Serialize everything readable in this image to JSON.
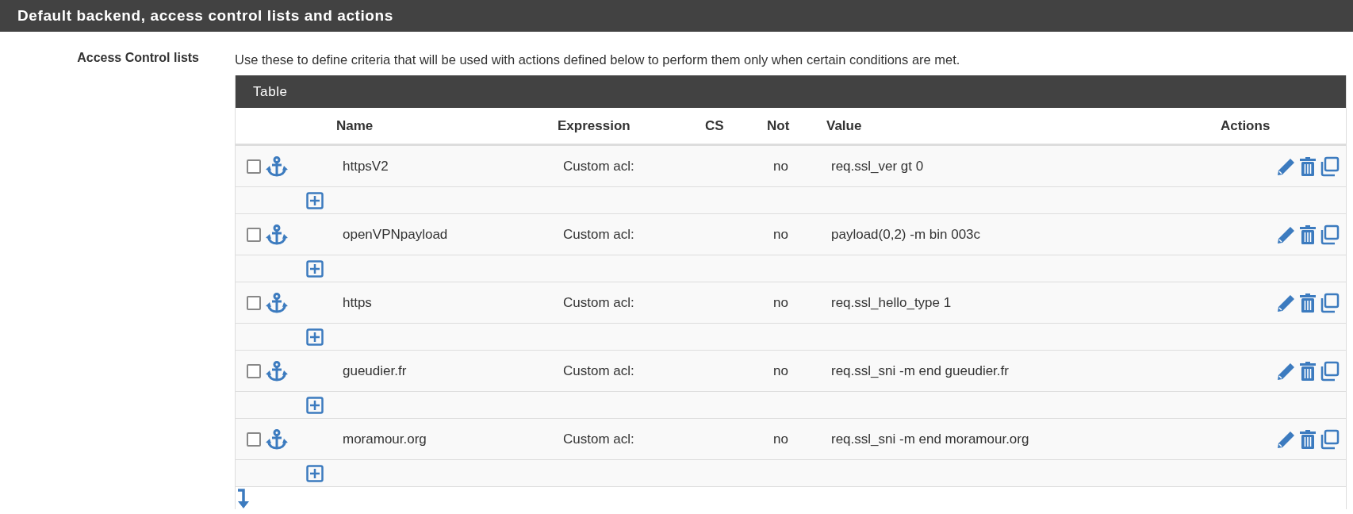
{
  "section_title": "Default backend, access control lists and actions",
  "field_label": "Access Control lists",
  "description": "Use these to define criteria that will be used with actions defined below to perform them only when certain conditions are met.",
  "table": {
    "title": "Table",
    "columns": [
      "Name",
      "Expression",
      "CS",
      "Not",
      "Value",
      "Actions"
    ],
    "rows": [
      {
        "checked": false,
        "name": "httpsV2",
        "expression": "Custom acl:",
        "not": "no",
        "value": "req.ssl_ver gt 0"
      },
      {
        "checked": false,
        "name": "openVPNpayload",
        "expression": "Custom acl:",
        "not": "no",
        "value": "payload(0,2) -m bin 003c"
      },
      {
        "checked": false,
        "name": "https",
        "expression": "Custom acl:",
        "not": "no",
        "value": "req.ssl_hello_type 1"
      },
      {
        "checked": false,
        "name": "gueudier.fr",
        "expression": "Custom acl:",
        "not": "no",
        "value": "req.ssl_sni -m end gueudier.fr"
      },
      {
        "checked": false,
        "name": "moramour.org",
        "expression": "Custom acl:",
        "not": "no",
        "value": "req.ssl_sni -m end moramour.org"
      }
    ]
  }
}
